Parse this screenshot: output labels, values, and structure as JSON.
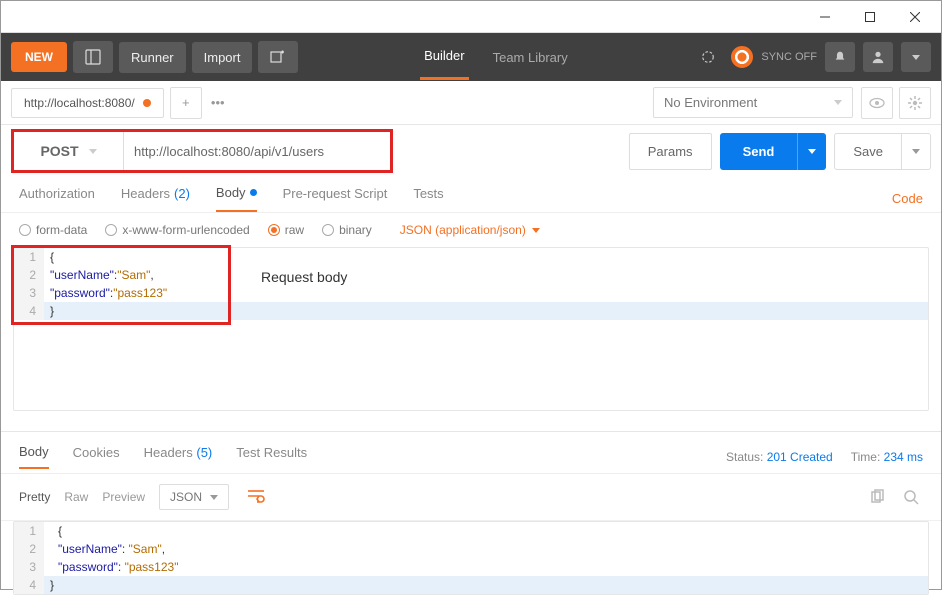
{
  "toolbar": {
    "new_label": "NEW",
    "runner_label": "Runner",
    "import_label": "Import",
    "builder_label": "Builder",
    "teamlib_label": "Team Library",
    "sync_label": "SYNC OFF"
  },
  "tab": {
    "title": "http://localhost:8080/"
  },
  "env": {
    "label": "No Environment"
  },
  "request": {
    "method": "POST",
    "url": "http://localhost:8080/api/v1/users",
    "params_label": "Params",
    "send_label": "Send",
    "save_label": "Save"
  },
  "subtabs": {
    "auth": "Authorization",
    "headers": "Headers",
    "headers_count": "(2)",
    "body": "Body",
    "prereq": "Pre-request Script",
    "tests": "Tests",
    "code": "Code"
  },
  "body": {
    "formdata": "form-data",
    "urlencoded": "x-www-form-urlencoded",
    "raw": "raw",
    "binary": "binary",
    "content_type": "JSON (application/json)",
    "annotation": "Request body",
    "lines": [
      "1",
      "2",
      "3",
      "4"
    ],
    "code": {
      "l1_open": "{",
      "l2_key": "\"userName\"",
      "l2_val": "\"Sam\"",
      "l3_key": "\"password\"",
      "l3_val": "\"pass123\"",
      "l4_close": "}"
    }
  },
  "response": {
    "tabs": {
      "body": "Body",
      "cookies": "Cookies",
      "headers": "Headers",
      "headers_count": "(5)",
      "tests": "Test Results"
    },
    "status_label": "Status:",
    "status_value": "201 Created",
    "time_label": "Time:",
    "time_value": "234 ms",
    "view": {
      "pretty": "Pretty",
      "raw": "Raw",
      "preview": "Preview",
      "json": "JSON"
    },
    "lines": [
      "1",
      "2",
      "3",
      "4"
    ],
    "code": {
      "l1_open": "{",
      "l2_key": "\"userName\"",
      "l2_val": "\"Sam\"",
      "l3_key": "\"password\"",
      "l3_val": "\"pass123\"",
      "l4_close": "}"
    }
  }
}
